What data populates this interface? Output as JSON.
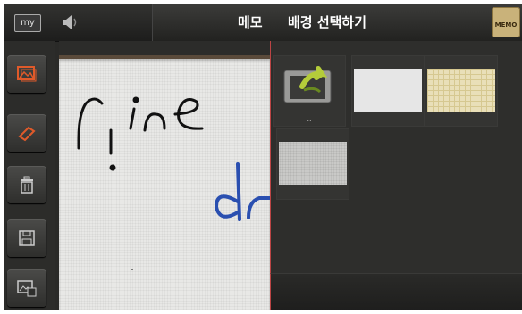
{
  "header": {
    "my_label": "my",
    "memo_title": "메모",
    "sheet_title": "배경 선택하기",
    "memo_icon_label": "MEMO"
  },
  "toolbar": {
    "tools": [
      "background-tool",
      "eraser-tool",
      "delete-tool",
      "save-tool",
      "export-tool"
    ]
  },
  "canvas": {
    "handwriting": [
      "fine",
      "dr"
    ],
    "ink_black": "#111111",
    "ink_blue": "#2a4fb0"
  },
  "backgrounds": {
    "folder_label": "..",
    "items": [
      {
        "name": "up-folder",
        "color": "#b9c48a"
      },
      {
        "name": "plain-white",
        "color": "#e6e6e6"
      },
      {
        "name": "beige-grid",
        "color": "#e9dfb8"
      },
      {
        "name": "grey-texture",
        "color": "#c9c9c7"
      }
    ]
  },
  "colors": {
    "accent": "#c4502a",
    "panel_divider": "#bb4444"
  }
}
